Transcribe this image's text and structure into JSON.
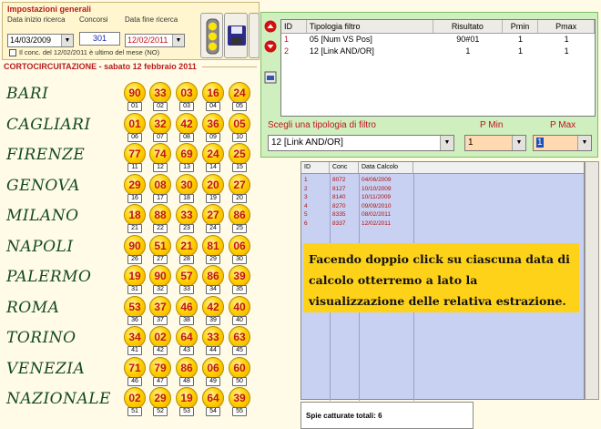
{
  "settings": {
    "title": "Impostazioni generali",
    "start_label": "Data inizio ricerca",
    "start_value": "14/03/2009",
    "concorsi_label": "Concorsi",
    "concorsi_value": "301",
    "end_label": "Data fine ricerca",
    "end_value": "12/02/2011",
    "checkbox_label": "Il conc. del 12/02/2011 è ultimo del mese (NO)"
  },
  "corto_title": "CORTOCIRCUITAZIONE - sabato 12 febbraio 2011",
  "wheels": [
    {
      "name": "BARI",
      "numbers": [
        "90",
        "33",
        "03",
        "16",
        "24"
      ],
      "subs": [
        "01",
        "02",
        "03",
        "04",
        "05"
      ]
    },
    {
      "name": "CAGLIARI",
      "numbers": [
        "01",
        "32",
        "42",
        "36",
        "05"
      ],
      "subs": [
        "06",
        "07",
        "08",
        "09",
        "10"
      ]
    },
    {
      "name": "FIRENZE",
      "numbers": [
        "77",
        "74",
        "69",
        "24",
        "25"
      ],
      "subs": [
        "11",
        "12",
        "13",
        "14",
        "15"
      ]
    },
    {
      "name": "GENOVA",
      "numbers": [
        "29",
        "08",
        "30",
        "20",
        "27"
      ],
      "subs": [
        "16",
        "17",
        "18",
        "19",
        "20"
      ]
    },
    {
      "name": "MILANO",
      "numbers": [
        "18",
        "88",
        "33",
        "27",
        "86"
      ],
      "subs": [
        "21",
        "22",
        "23",
        "24",
        "25"
      ]
    },
    {
      "name": "NAPOLI",
      "numbers": [
        "90",
        "51",
        "21",
        "81",
        "06"
      ],
      "subs": [
        "26",
        "27",
        "28",
        "29",
        "30"
      ]
    },
    {
      "name": "PALERMO",
      "numbers": [
        "19",
        "90",
        "57",
        "86",
        "39"
      ],
      "subs": [
        "31",
        "32",
        "33",
        "34",
        "35"
      ]
    },
    {
      "name": "ROMA",
      "numbers": [
        "53",
        "37",
        "46",
        "42",
        "40"
      ],
      "subs": [
        "36",
        "37",
        "38",
        "39",
        "40"
      ]
    },
    {
      "name": "TORINO",
      "numbers": [
        "34",
        "02",
        "64",
        "33",
        "63"
      ],
      "subs": [
        "41",
        "42",
        "43",
        "44",
        "45"
      ]
    },
    {
      "name": "VENEZIA",
      "numbers": [
        "71",
        "79",
        "86",
        "06",
        "60"
      ],
      "subs": [
        "46",
        "47",
        "48",
        "49",
        "50"
      ]
    },
    {
      "name": "NAZIONALE",
      "numbers": [
        "02",
        "29",
        "19",
        "64",
        "39"
      ],
      "subs": [
        "51",
        "52",
        "53",
        "54",
        "55"
      ]
    }
  ],
  "filter": {
    "headers": [
      "ID",
      "Tipologia filtro",
      "Risultato",
      "Pmin",
      "Pmax"
    ],
    "rows": [
      {
        "id": "1",
        "tipologia": "05 [Num VS Pos]",
        "risultato": "90#01",
        "pmin": "1",
        "pmax": "1"
      },
      {
        "id": "2",
        "tipologia": "12 [Link AND/OR]",
        "risultato": "1",
        "pmin": "1",
        "pmax": "1"
      }
    ],
    "type_label": "Scegli una tipologia di filtro",
    "type_value": "12 [Link AND/OR]",
    "pmin_label": "P Min",
    "pmin_value": "1",
    "pmax_label": "P Max",
    "pmax_value": "1"
  },
  "results": {
    "headers": [
      "ID",
      "Conc",
      "Data Calcolo"
    ],
    "rows": [
      {
        "id": "1",
        "conc": "8072",
        "date": "04/06/2009"
      },
      {
        "id": "2",
        "conc": "8127",
        "date": "10/10/2009"
      },
      {
        "id": "3",
        "conc": "8140",
        "date": "10/11/2009"
      },
      {
        "id": "4",
        "conc": "8270",
        "date": "09/09/2010"
      },
      {
        "id": "5",
        "conc": "8335",
        "date": "08/02/2011"
      },
      {
        "id": "6",
        "conc": "8337",
        "date": "12/02/2011"
      }
    ]
  },
  "info_text": "Facendo doppio click su ciascuna data di calcolo otterremo a lato la visualizzazione delle relativa estrazione.",
  "spie_label": "Spie catturate totali: 6"
}
